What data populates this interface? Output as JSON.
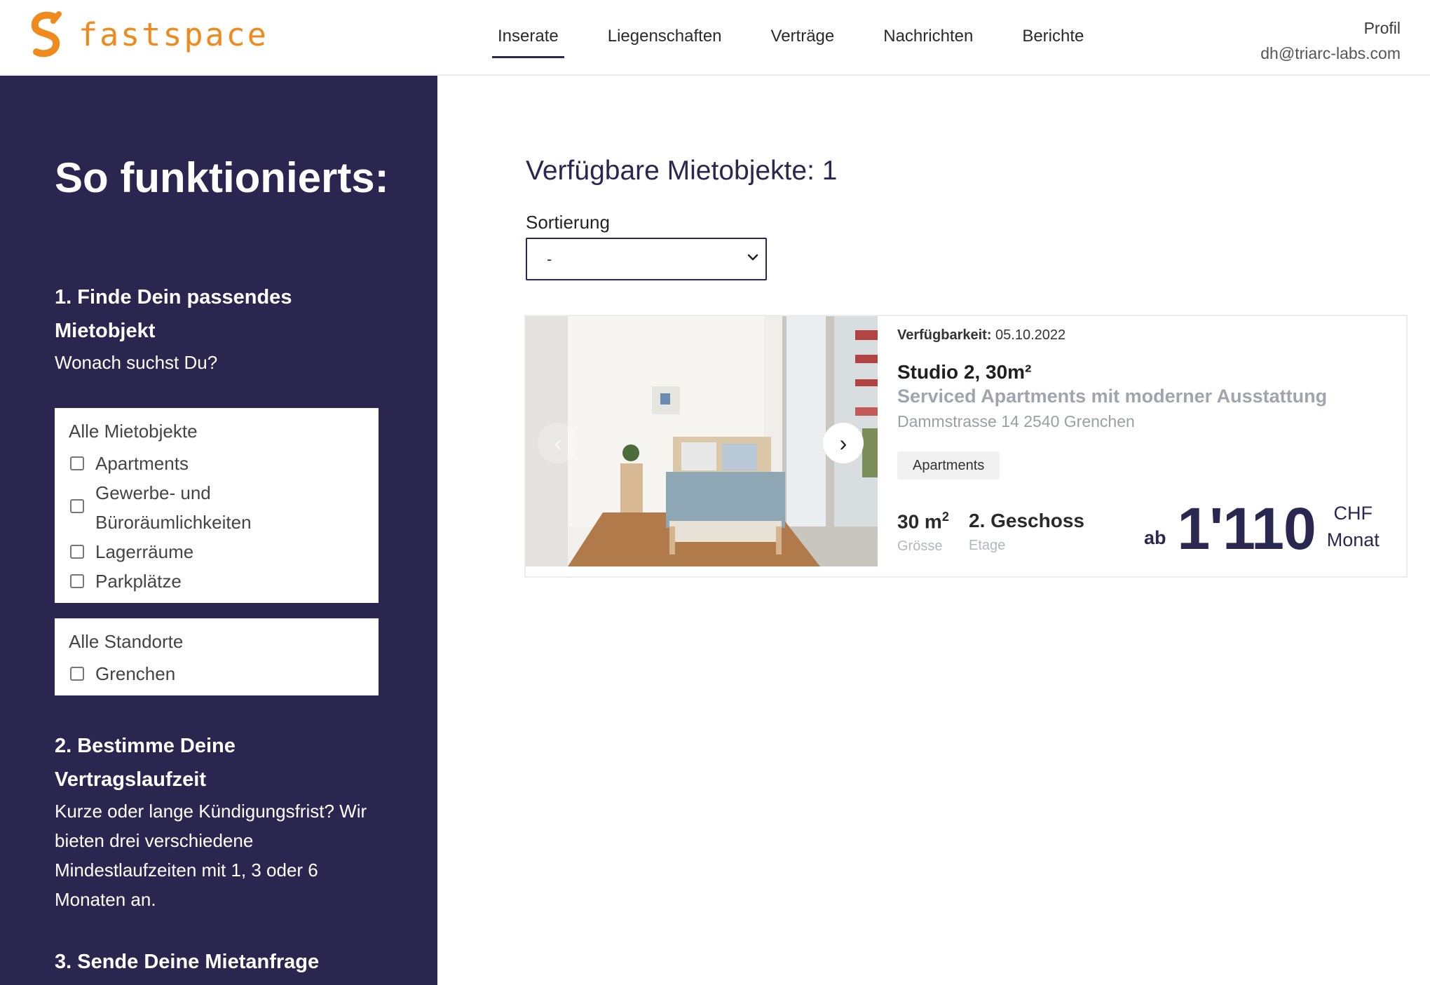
{
  "app": {
    "brand": "fastspace",
    "brand_color": "#f08a1c",
    "sidebar_color": "#2a264f"
  },
  "header": {
    "nav": [
      {
        "label": "Inserate",
        "active": true
      },
      {
        "label": "Liegenschaften",
        "active": false
      },
      {
        "label": "Verträge",
        "active": false
      },
      {
        "label": "Nachrichten",
        "active": false
      },
      {
        "label": "Berichte",
        "active": false
      }
    ],
    "profile_label": "Profil",
    "profile_email": "dh@triarc-labs.com"
  },
  "sidebar": {
    "title": "So funktionierts:",
    "step1": {
      "heading": "1. Finde Dein passendes Mietobjekt",
      "text": "Wonach suchst Du?"
    },
    "filter_types": {
      "title": "Alle Mietobjekte",
      "options": [
        {
          "label": "Apartments",
          "checked": false
        },
        {
          "label": "Gewerbe- und Büroräumlichkeiten",
          "checked": false
        },
        {
          "label": "Lagerräume",
          "checked": false
        },
        {
          "label": "Parkplätze",
          "checked": false
        }
      ]
    },
    "filter_locations": {
      "title": "Alle Standorte",
      "options": [
        {
          "label": "Grenchen",
          "checked": false
        }
      ]
    },
    "step2": {
      "heading": "2. Bestimme Deine Vertragslaufzeit",
      "text": "Kurze oder lange Kündigungsfrist? Wir bieten drei verschiedene Mindestlaufzeiten mit 1, 3 oder 6 Monaten an."
    },
    "step3": {
      "heading": "3. Sende Deine Mietanfrage"
    }
  },
  "main": {
    "title": "Verfügbare Mietobjekte: 1",
    "sort_label": "Sortierung",
    "sort_value": "-",
    "listing": {
      "availability_label": "Verfügbarkeit:",
      "availability_date": "05.10.2022",
      "title": "Studio 2, 30m²",
      "subtitle": "Serviced Apartments mit moderner Ausstattung",
      "address": "Dammstrasse 14 2540 Grenchen",
      "tag": "Apartments",
      "size_value": "30 m",
      "size_sup": "2",
      "size_label": "Grösse",
      "floor_value": "2. Geschoss",
      "floor_label": "Etage",
      "price_prefix": "ab",
      "price": "1'110",
      "currency": "CHF",
      "period": "Monat",
      "carousel_prev": "‹",
      "carousel_next": "›"
    }
  }
}
